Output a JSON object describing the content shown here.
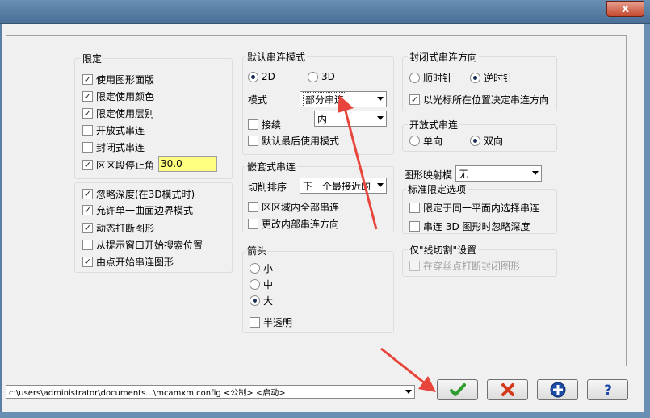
{
  "window": {
    "close_label": "x"
  },
  "limit_group": {
    "title": "限定",
    "items": [
      {
        "label": "使用图形面版",
        "checked": true
      },
      {
        "label": "限定使用颜色",
        "checked": true
      },
      {
        "label": "限定使用层别",
        "checked": true
      },
      {
        "label": "开放式串连",
        "checked": false
      },
      {
        "label": "封闭式串连",
        "checked": false
      },
      {
        "label": "区区段停止角",
        "checked": true
      }
    ],
    "angle_value": "30.0"
  },
  "lower_left": {
    "items": [
      {
        "label": "忽略深度(在3D模式时)",
        "checked": true
      },
      {
        "label": "允许单一曲面边界模式",
        "checked": true
      },
      {
        "label": "动态打断图形",
        "checked": true
      },
      {
        "label": "从提示窗口开始搜索位置",
        "checked": false
      },
      {
        "label": "由点开始串连图形",
        "checked": true
      }
    ]
  },
  "default_chain": {
    "title": "默认串连模式",
    "radio_2d": "2D",
    "radio_3d": "3D",
    "mode_label": "模式",
    "mode_value": "部分串连",
    "inner_value": "内",
    "connect_label": "接续",
    "last_mode_label": "默认最后使用模式"
  },
  "nested": {
    "title": "嵌套式串连",
    "sort_label": "切削排序",
    "sort_value": "下一个最接近的",
    "items": [
      {
        "label": "区区域内全部串连",
        "checked": false
      },
      {
        "label": "更改内部串连方向",
        "checked": false
      }
    ]
  },
  "arrow": {
    "title": "箭头",
    "options": [
      {
        "label": "小",
        "selected": false
      },
      {
        "label": "中",
        "selected": false
      },
      {
        "label": "大",
        "selected": true
      }
    ],
    "translucent_label": "半透明"
  },
  "closed_dir": {
    "title": "封闭式串连方向",
    "cw": "顺时针",
    "ccw": "逆时针",
    "cursor_label": "以光标所在位置决定串连方向"
  },
  "open_chain": {
    "title": "开放式串连",
    "single": "单向",
    "double": "双向"
  },
  "mapping": {
    "label": "图形映射模",
    "value": "无"
  },
  "standard": {
    "title": "标准限定选项",
    "items": [
      {
        "label": "限定于同一平面内选择串连",
        "checked": false
      },
      {
        "label": "串连 3D 图形时忽略深度",
        "checked": false
      }
    ]
  },
  "wire": {
    "title": "仅\"线切割\"设置",
    "item": "在穿丝点打断封闭图形"
  },
  "status": {
    "path": "c:\\users\\administrator\\documents...\\mcamxm.config <公制> <启动>"
  },
  "colors": {
    "accent": "#2e9c2e",
    "cancel": "#d23a1a",
    "help": "#1d4aa6",
    "highlight_input": "#ffff80",
    "annotation_arrow": "#e8453c"
  }
}
